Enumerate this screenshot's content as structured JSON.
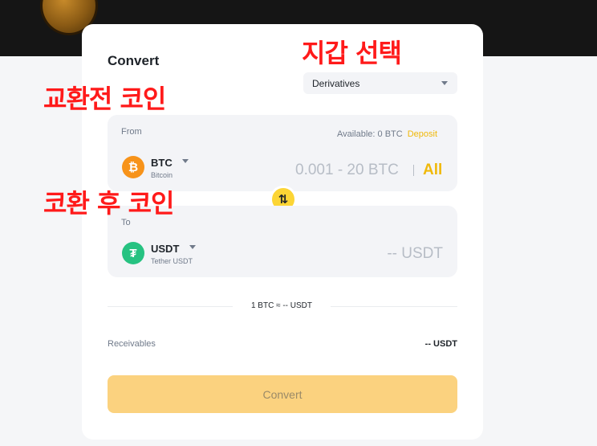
{
  "header": {
    "title": "Convert"
  },
  "wallet": {
    "selected": "Derivatives"
  },
  "from": {
    "label": "From",
    "available": "Available: 0 BTC",
    "deposit": "Deposit",
    "symbol": "BTC",
    "name": "Bitcoin",
    "coin_glyph": "₿",
    "amount_placeholder": "0.001 - 20 BTC",
    "all": "All"
  },
  "to": {
    "label": "To",
    "symbol": "USDT",
    "name": "Tether USDT",
    "coin_glyph": "₮",
    "amount_placeholder": "-- USDT"
  },
  "swap_glyph": "⇅",
  "rate": "1 BTC ≈ -- USDT",
  "receivables": {
    "label": "Receivables",
    "value": "-- USDT"
  },
  "convert_button": "Convert",
  "annotations": {
    "wallet": "지갑 선택",
    "from_coin": "교환전 코인",
    "to_coin": "코환 후 코인"
  },
  "colors": {
    "accent": "#f0b90b",
    "button_disabled": "#fbd27f",
    "btc": "#f7931a",
    "usdt": "#26c281",
    "annotation": "#ff1a1a"
  }
}
